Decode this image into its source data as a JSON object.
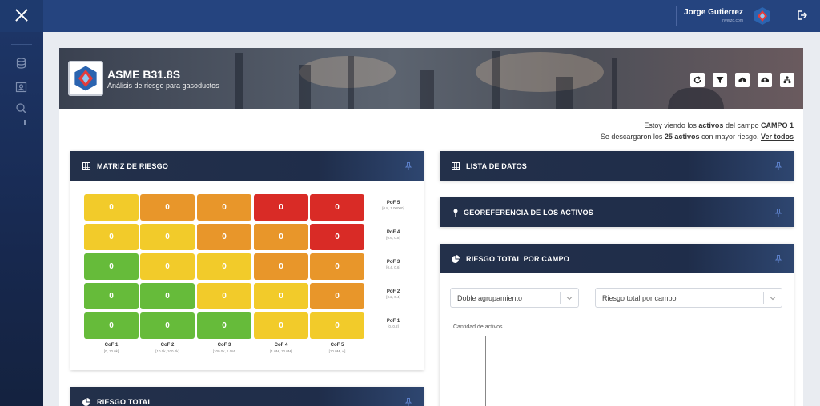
{
  "user": {
    "name": "Jorge Gutierrez",
    "subtitle": "inverzo.com"
  },
  "app": {
    "title": "ASME B31.8S",
    "subtitle": "Análisis de riesgo para gasoductos"
  },
  "info": {
    "line1_prefix": "Estoy viendo los ",
    "line1_bold1": "activos",
    "line1_mid": " del campo ",
    "line1_bold2": "CAMPO 1",
    "line2_prefix": "Se descargaron los ",
    "line2_bold": "25 activos",
    "line2_mid": " con mayor riesgo. ",
    "line2_link": "Ver todos"
  },
  "cards": {
    "matrix": "MATRIZ DE RIESGO",
    "lista": "LISTA DE DATOS",
    "geo": "GEOREFERENCIA DE LOS ACTIVOS",
    "riesgo_campo": "RIESGO TOTAL POR CAMPO",
    "riesgo_total": "RIESGO TOTAL"
  },
  "matrix": {
    "rows": [
      {
        "pof": "PoF 5",
        "range": "[0.8, 1.00000]",
        "cells": [
          {
            "v": "0",
            "c": "y"
          },
          {
            "v": "0",
            "c": "o"
          },
          {
            "v": "0",
            "c": "o"
          },
          {
            "v": "0",
            "c": "r"
          },
          {
            "v": "0",
            "c": "r"
          }
        ]
      },
      {
        "pof": "PoF 4",
        "range": "[0.6, 0.8]",
        "cells": [
          {
            "v": "0",
            "c": "y"
          },
          {
            "v": "0",
            "c": "y"
          },
          {
            "v": "0",
            "c": "o"
          },
          {
            "v": "0",
            "c": "o"
          },
          {
            "v": "0",
            "c": "r"
          }
        ]
      },
      {
        "pof": "PoF 3",
        "range": "[0.4, 0.6]",
        "cells": [
          {
            "v": "0",
            "c": "g"
          },
          {
            "v": "0",
            "c": "y"
          },
          {
            "v": "0",
            "c": "y"
          },
          {
            "v": "0",
            "c": "o"
          },
          {
            "v": "0",
            "c": "o"
          }
        ]
      },
      {
        "pof": "PoF 2",
        "range": "[0.2, 0.4]",
        "cells": [
          {
            "v": "0",
            "c": "g"
          },
          {
            "v": "0",
            "c": "g"
          },
          {
            "v": "0",
            "c": "y"
          },
          {
            "v": "0",
            "c": "y"
          },
          {
            "v": "0",
            "c": "o"
          }
        ]
      },
      {
        "pof": "PoF 1",
        "range": "[0, 0.2]",
        "cells": [
          {
            "v": "0",
            "c": "g"
          },
          {
            "v": "0",
            "c": "g"
          },
          {
            "v": "0",
            "c": "g"
          },
          {
            "v": "0",
            "c": "y"
          },
          {
            "v": "0",
            "c": "y"
          }
        ]
      }
    ],
    "cof": [
      {
        "label": "CoF 1",
        "range": "[0, 10.0k]"
      },
      {
        "label": "CoF 2",
        "range": "[10.0k, 100.0k]"
      },
      {
        "label": "CoF 3",
        "range": "[100.0k, 1.0M]"
      },
      {
        "label": "CoF 4",
        "range": "[1.0M, 10.0M]"
      },
      {
        "label": "CoF 5",
        "range": "[10.0M, ∞]"
      }
    ],
    "colors": {
      "g": "#66bb3a",
      "y": "#f2cb2a",
      "o": "#e8962a",
      "r": "#d92b26"
    }
  },
  "filters": {
    "group": "Doble agrupamiento",
    "metric": "Riesgo total por campo"
  },
  "chart": {
    "ylabel": "Cantidad de activos"
  },
  "toolbar_icons": [
    "refresh-icon",
    "filter-icon",
    "cloud-download-icon",
    "cloud-upload-icon",
    "sitemap-icon"
  ]
}
